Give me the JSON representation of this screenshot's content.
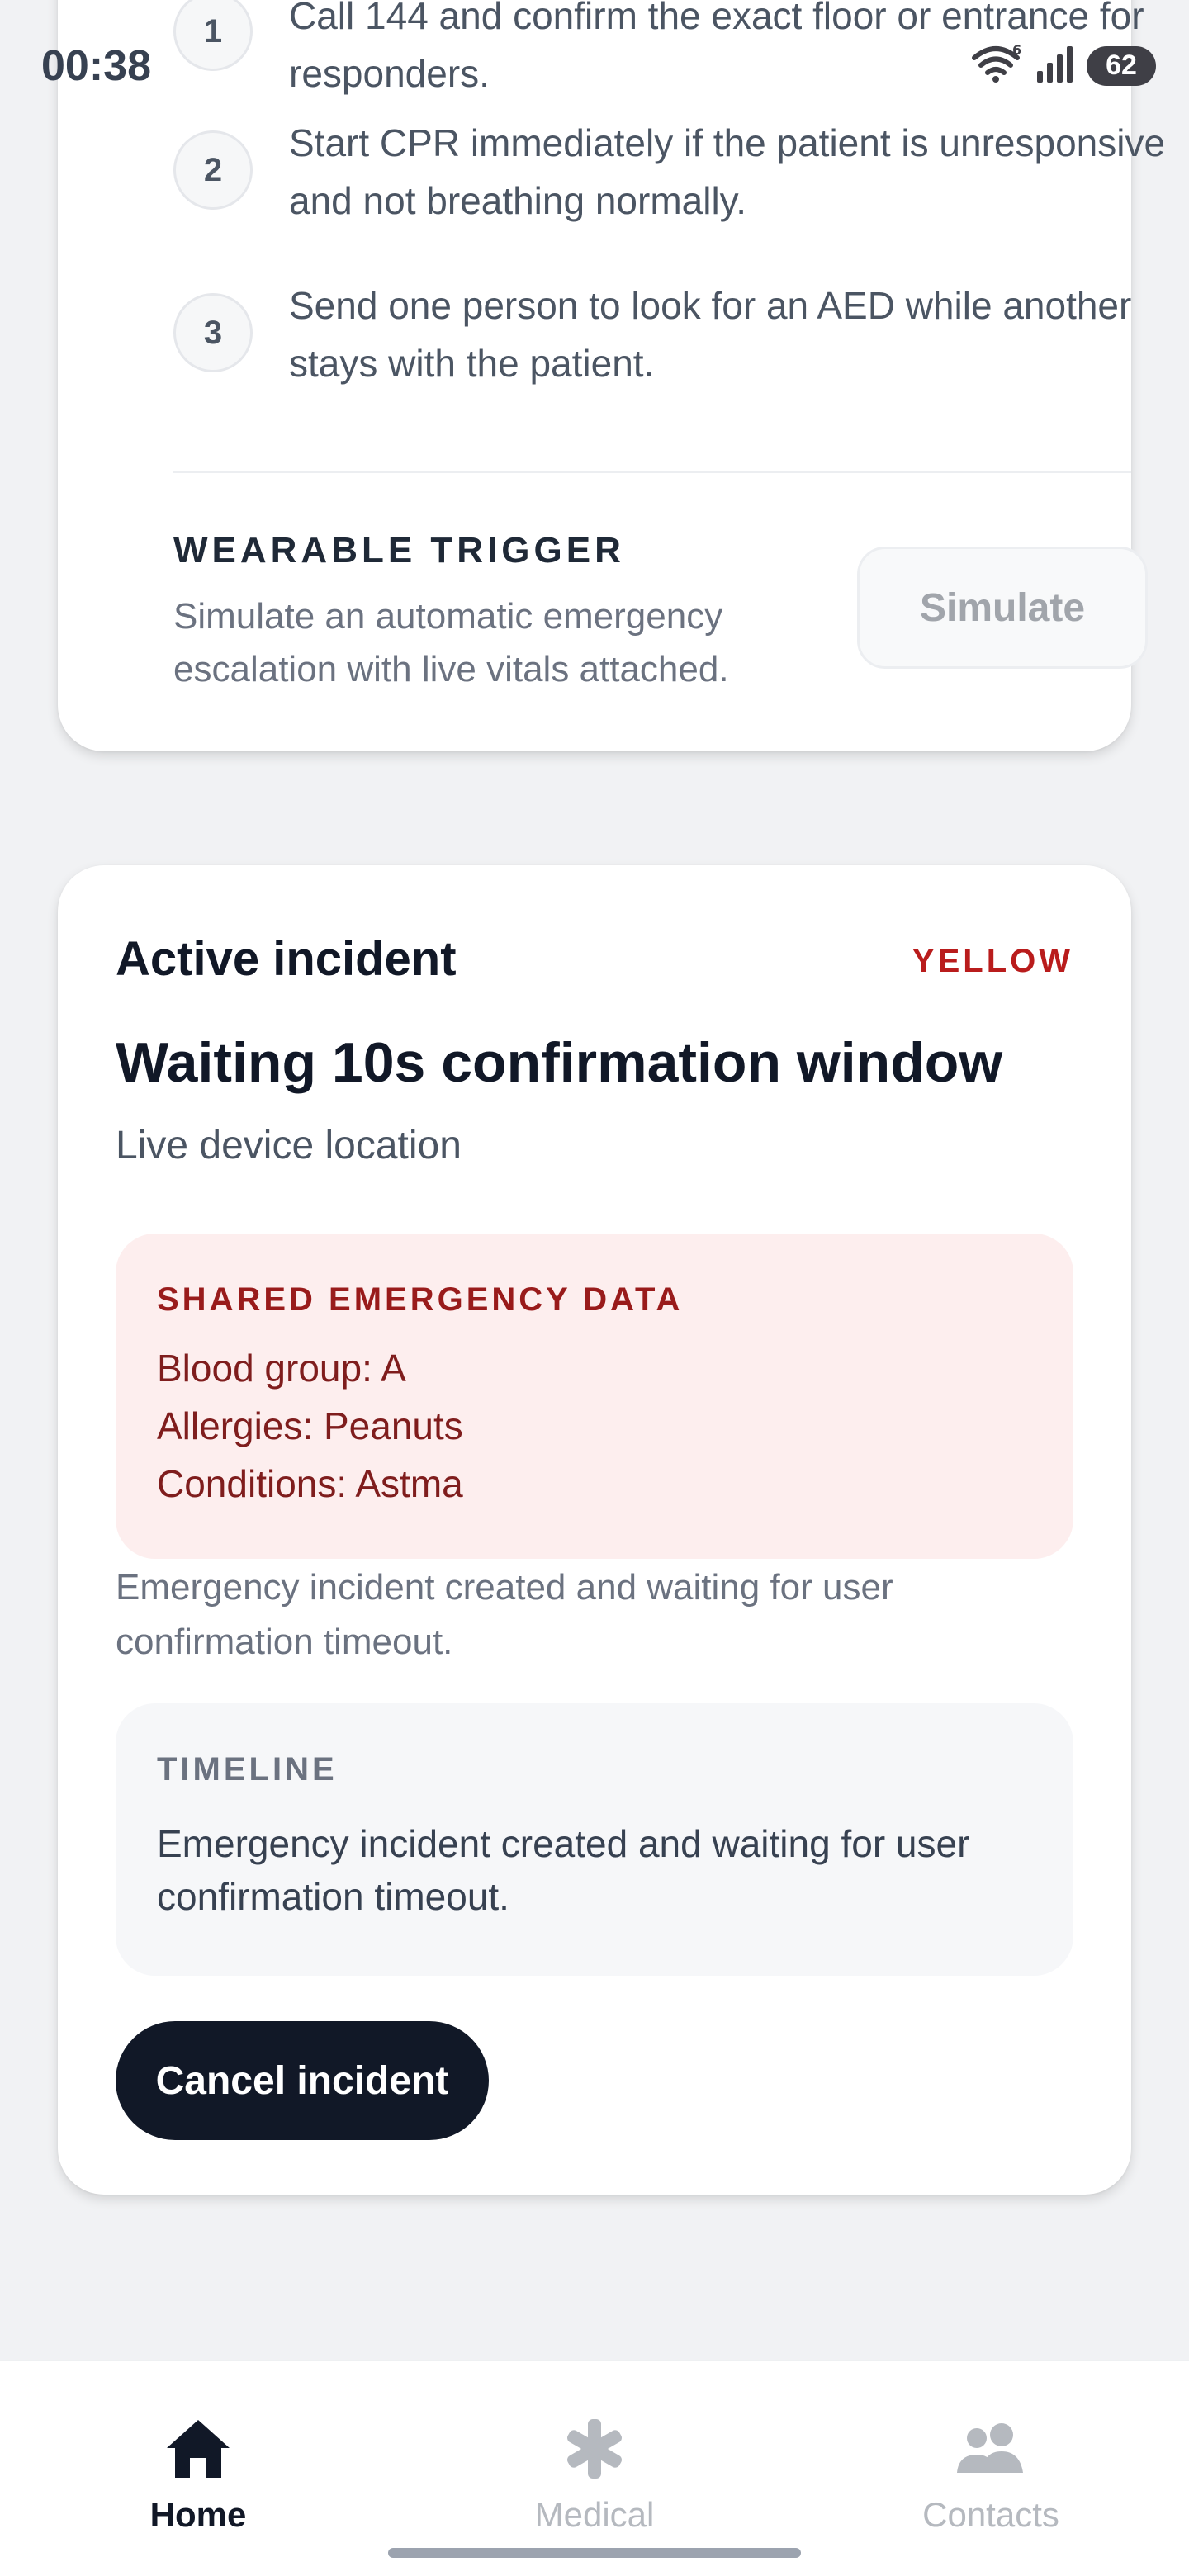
{
  "status_bar": {
    "time": "00:38",
    "battery": "62",
    "wifi_label": "6",
    "icons": [
      "wifi-icon",
      "signal-icon",
      "battery-icon"
    ]
  },
  "steps": [
    {
      "number": "1",
      "text": "Call 144 and confirm the exact floor or entrance for responders."
    },
    {
      "number": "2",
      "text": "Start CPR immediately if the patient is unresponsive and not breathing normally."
    },
    {
      "number": "3",
      "text": "Send one person to look for an AED while another stays with the patient."
    }
  ],
  "wearable": {
    "title": "WEARABLE TRIGGER",
    "description": "Simulate an automatic emergency escalation with live vitals attached.",
    "button_label": "Simulate"
  },
  "incident": {
    "title": "Active incident",
    "badge": "YELLOW",
    "status": "Waiting 10s confirmation window",
    "location": "Live device location",
    "shared": {
      "title": "SHARED EMERGENCY DATA",
      "lines": [
        "Blood group: A",
        "Allergies: Peanuts",
        "Conditions: Astma"
      ]
    },
    "note": "Emergency incident created and waiting for user confirmation timeout.",
    "timeline": {
      "title": "TIMELINE",
      "text": "Emergency incident created and waiting for user confirmation timeout."
    },
    "cancel_label": "Cancel incident"
  },
  "colors": {
    "badge": "#b91c1c",
    "shared_bg": "#fdeeee",
    "primary_button": "#111827"
  },
  "nav": {
    "items": [
      {
        "label": "Home",
        "icon": "home-icon",
        "active": true
      },
      {
        "label": "Medical",
        "icon": "medical-asterisk-icon",
        "active": false
      },
      {
        "label": "Contacts",
        "icon": "contacts-icon",
        "active": false
      }
    ]
  }
}
